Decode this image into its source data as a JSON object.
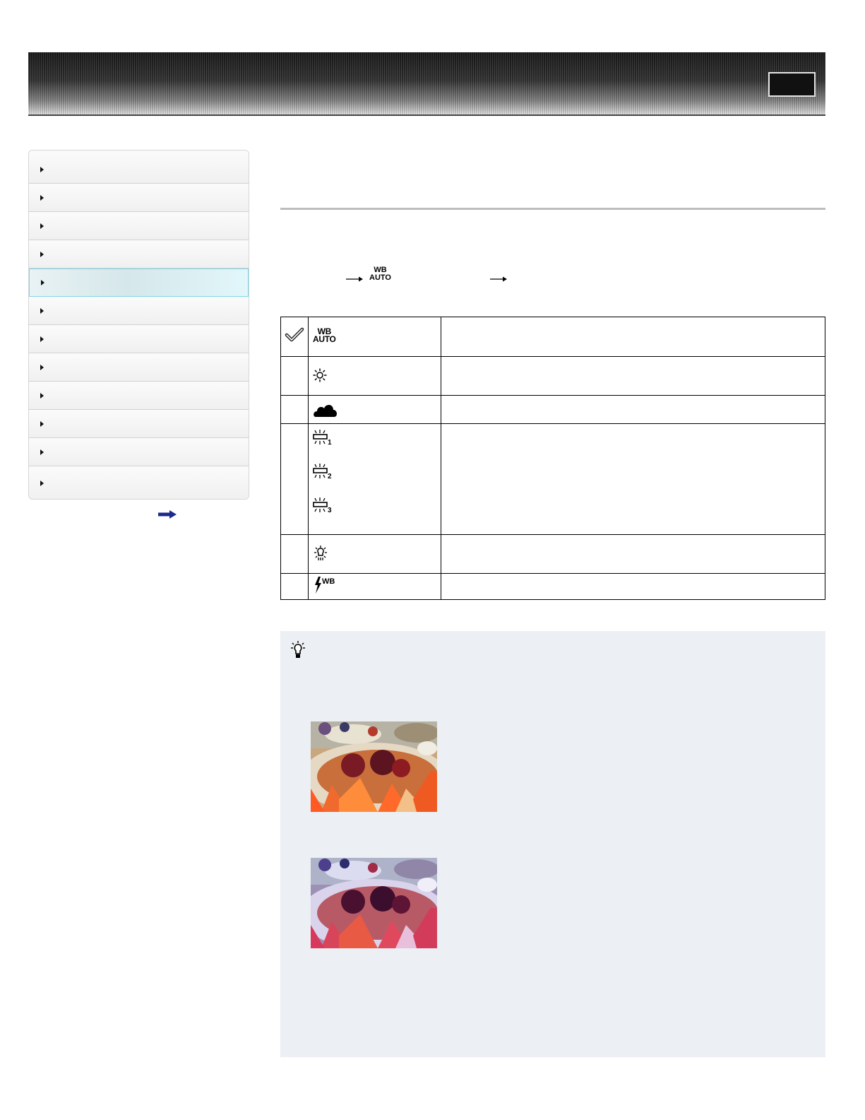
{
  "header": {
    "banner_button_label": ""
  },
  "sidebar": {
    "items": [
      {
        "label": ""
      },
      {
        "label": ""
      },
      {
        "label": ""
      },
      {
        "label": ""
      },
      {
        "label": "",
        "active": true
      },
      {
        "label": ""
      },
      {
        "label": ""
      },
      {
        "label": ""
      },
      {
        "label": ""
      },
      {
        "label": ""
      },
      {
        "label": ""
      },
      {
        "label": ""
      }
    ],
    "more_icon": "arrow-right-icon"
  },
  "procedure": {
    "wb_icon_top": "WB",
    "wb_icon_bottom": "AUTO"
  },
  "options": [
    {
      "icon": "wb-auto-icon",
      "icon_text_top": "WB",
      "icon_text_bottom": "AUTO",
      "selected": true,
      "description": ""
    },
    {
      "icon": "daylight-icon",
      "selected": false,
      "description": ""
    },
    {
      "icon": "cloudy-icon",
      "selected": false,
      "description": ""
    },
    {
      "icon": "fluorescent-icons",
      "sub_icons": [
        "1",
        "2",
        "3"
      ],
      "selected": false,
      "description": ""
    },
    {
      "icon": "incandescent-icon",
      "selected": false,
      "description": ""
    },
    {
      "icon": "flash-wb-icon",
      "icon_text": "WB",
      "selected": false,
      "description": ""
    }
  ],
  "hint": {
    "icon": "lightbulb-hint-icon",
    "photos": [
      "food-photo-warm",
      "food-photo-cool"
    ]
  },
  "colors": {
    "active_border": "#7fd6e6",
    "hint_background": "#eceff4",
    "title_rule": "#bdbdbd"
  }
}
